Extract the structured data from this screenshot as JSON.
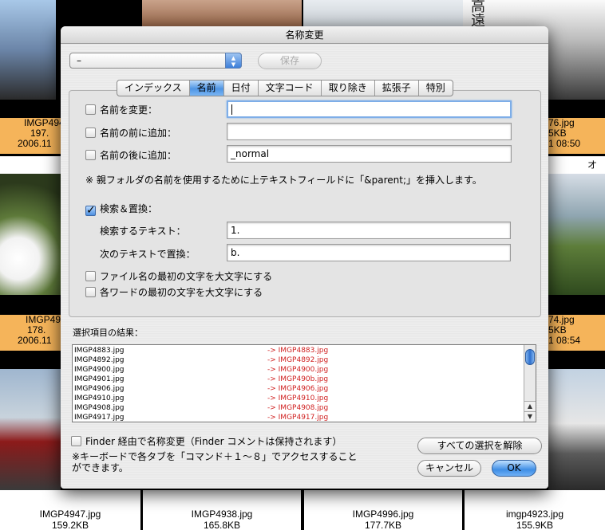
{
  "background": {
    "top_captions": [
      {
        "name": "IMGP494",
        "size": "197.",
        "date": "2006.11"
      },
      {
        "name": "76.jpg",
        "size": "5KB",
        "date": "1 08:50"
      }
    ],
    "mid_captions": [
      {
        "name": "IMGP49",
        "size": "178.",
        "date": "2006.11"
      },
      {
        "name": "74.jpg",
        "size": "5KB",
        "date": "1 08:54"
      }
    ],
    "right_text": "オレ",
    "sign_text": "高\n遠\nか",
    "bottom_files": [
      {
        "name": "IMGP4947.jpg",
        "size": "159.2KB"
      },
      {
        "name": "IMGP4938.jpg",
        "size": "165.8KB"
      },
      {
        "name": "IMGP4996.jpg",
        "size": "177.7KB"
      },
      {
        "name": "imgp4923.jpg",
        "size": "155.9KB"
      }
    ]
  },
  "dialog": {
    "title": "名称変更",
    "preset_value": "–",
    "save_label": "保存",
    "tabs": [
      "インデックス",
      "名前",
      "日付",
      "文字コード",
      "取り除き",
      "拡張子",
      "特別"
    ],
    "active_tab": "名前",
    "change_name_label": "名前を変更：",
    "change_name_value": "",
    "prefix_label": "名前の前に追加：",
    "prefix_value": "",
    "suffix_label": "名前の後に追加：",
    "suffix_value": "_normal",
    "note": "※ 親フォルダの名前を使用するために上テキストフィールドに「&parent;」を挿入します。",
    "search_replace_label": "検索＆置換：",
    "search_replace_checked": true,
    "search_label": "検索するテキスト：",
    "search_value": "1.",
    "replace_label": "次のテキストで置換：",
    "replace_value": "b.",
    "capitalize_first_label": "ファイル名の最初の文字を大文字にする",
    "capitalize_words_label": "各ワードの最初の文字を大文字にする",
    "results_label": "選択項目の結果：",
    "results": [
      {
        "old": "IMGP4883.jpg",
        "new": "-> IMGP4883.jpg"
      },
      {
        "old": "IMGP4892.jpg",
        "new": "-> IMGP4892.jpg"
      },
      {
        "old": "IMGP4900.jpg",
        "new": "-> IMGP4900.jpg"
      },
      {
        "old": "IMGP4901.jpg",
        "new": "-> IMGP490b.jpg"
      },
      {
        "old": "IMGP4906.jpg",
        "new": "-> IMGP4906.jpg"
      },
      {
        "old": "IMGP4910.jpg",
        "new": "-> IMGP4910.jpg"
      },
      {
        "old": "IMGP4908.jpg",
        "new": "-> IMGP4908.jpg"
      },
      {
        "old": "IMGP4917.jpg",
        "new": "-> IMGP4917.jpg"
      }
    ],
    "finder_label": "Finder 経由で名称変更（Finder コメントは保持されます）",
    "shortcut_note": "※キーボードで各タブを「コマンド＋１〜８」でアクセスすることができます。",
    "deselect_all_label": "すべての選択を解除",
    "cancel_label": "キャンセル",
    "ok_label": "OK"
  },
  "colors": {
    "caption": "#f5b45a",
    "accent": "#3f8ee5",
    "result_new": "#d02020"
  }
}
